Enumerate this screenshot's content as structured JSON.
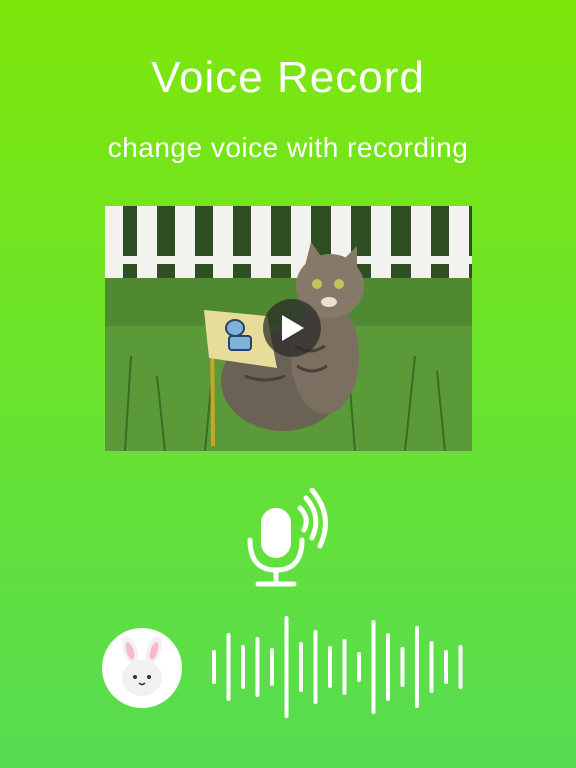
{
  "header": {
    "title": "Voice Record",
    "subtitle": "change voice with recording"
  },
  "video": {
    "thumbnail": "cat sitting on grass with flag",
    "play_icon": "play-icon"
  },
  "icons": {
    "mic": "microphone-icon",
    "avatar": "bunny-avatar",
    "waveform": "waveform-icon"
  },
  "colors": {
    "background_top": "#7ee60a",
    "background_bottom": "#56dc52",
    "foreground": "#ffffff"
  }
}
